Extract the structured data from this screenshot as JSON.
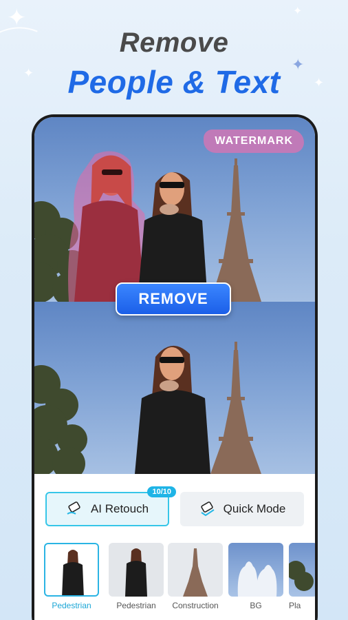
{
  "headline": {
    "line1": "Remove",
    "line2": "People & Text"
  },
  "top_photo": {
    "watermark_text": "WATERMARK"
  },
  "remove_button": {
    "label": "REMOVE"
  },
  "modes": [
    {
      "label": "AI Retouch",
      "badge": "10/10",
      "icon": "eraser-icon",
      "selected": true
    },
    {
      "label": "Quick Mode",
      "icon": "quick-eraser-icon",
      "selected": false
    }
  ],
  "categories": [
    {
      "label": "Pedestrian",
      "selected": true
    },
    {
      "label": "Pedestrian",
      "selected": false
    },
    {
      "label": "Construction",
      "selected": false
    },
    {
      "label": "BG",
      "selected": false
    },
    {
      "label": "Pla",
      "selected": false
    }
  ],
  "colors": {
    "headline_gray": "#4a4a4a",
    "headline_blue": "#1f6ae6",
    "remove_button": "#1b5fe8",
    "watermark_bg": "#c07ab8",
    "accent_cyan": "#2ab4e4"
  }
}
